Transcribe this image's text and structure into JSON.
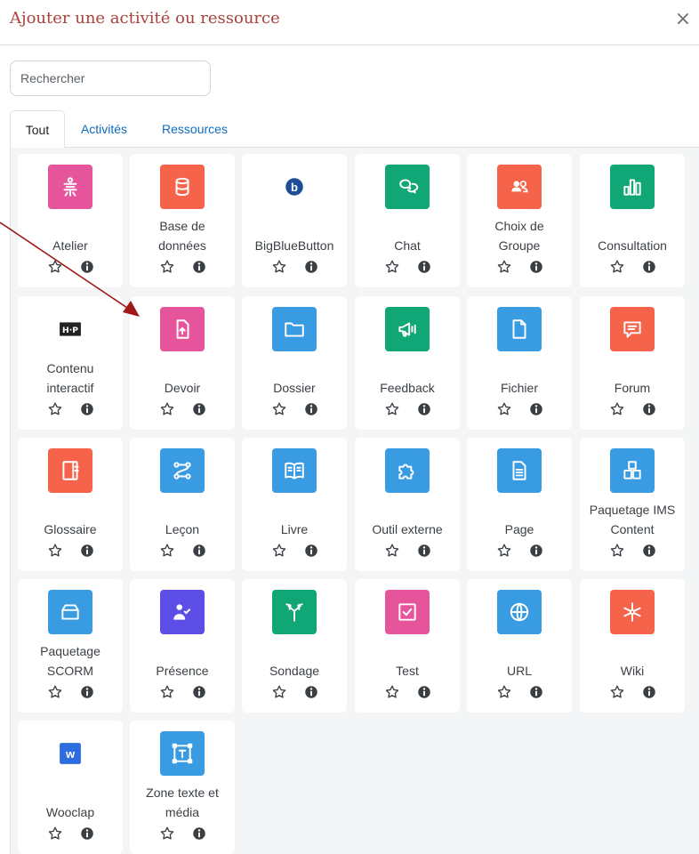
{
  "modal": {
    "title": "Ajouter une activité ou ressource",
    "close_glyph": "×"
  },
  "search": {
    "placeholder": "Rechercher",
    "value": ""
  },
  "tabs": [
    {
      "label": "Tout",
      "active": true
    },
    {
      "label": "Activités",
      "active": false
    },
    {
      "label": "Ressources",
      "active": false
    }
  ],
  "colors": {
    "title": "#a8423a",
    "link": "#0f6cbf",
    "pink": "#e6559b",
    "coral": "#f5634a",
    "green": "#11a676",
    "blue": "#399be2",
    "purple": "#5c4ee6",
    "annotation_arrow": "#a01818"
  },
  "items": [
    {
      "label": "Atelier",
      "icon": "atelier-icon",
      "color": "#e6559b"
    },
    {
      "label": "Base de\ndonnées",
      "icon": "database-icon",
      "color": "#f5634a"
    },
    {
      "label": "BigBlueButton",
      "icon": "bigbluebutton-icon",
      "color": ""
    },
    {
      "label": "Chat",
      "icon": "chat-icon",
      "color": "#11a676"
    },
    {
      "label": "Choix de\nGroupe",
      "icon": "group-choice-icon",
      "color": "#f5634a"
    },
    {
      "label": "Consultation",
      "icon": "bar-chart-icon",
      "color": "#11a676"
    },
    {
      "label": "Contenu\ninteractif",
      "icon": "h5p-icon",
      "color": ""
    },
    {
      "label": "Devoir",
      "icon": "assignment-icon",
      "color": "#e6559b"
    },
    {
      "label": "Dossier",
      "icon": "folder-icon",
      "color": "#399be2"
    },
    {
      "label": "Feedback",
      "icon": "megaphone-icon",
      "color": "#11a676"
    },
    {
      "label": "Fichier",
      "icon": "file-icon",
      "color": "#399be2"
    },
    {
      "label": "Forum",
      "icon": "forum-icon",
      "color": "#f5634a"
    },
    {
      "label": "Glossaire",
      "icon": "glossary-icon",
      "color": "#f5634a"
    },
    {
      "label": "Leçon",
      "icon": "lesson-icon",
      "color": "#399be2"
    },
    {
      "label": "Livre",
      "icon": "book-icon",
      "color": "#399be2"
    },
    {
      "label": "Outil externe",
      "icon": "puzzle-icon",
      "color": "#399be2"
    },
    {
      "label": "Page",
      "icon": "page-icon",
      "color": "#399be2"
    },
    {
      "label": "Paquetage IMS\nContent",
      "icon": "ims-package-icon",
      "color": "#399be2"
    },
    {
      "label": "Paquetage\nSCORM",
      "icon": "scorm-package-icon",
      "color": "#399be2"
    },
    {
      "label": "Présence",
      "icon": "attendance-icon",
      "color": "#5c4ee6"
    },
    {
      "label": "Sondage",
      "icon": "survey-icon",
      "color": "#11a676"
    },
    {
      "label": "Test",
      "icon": "quiz-icon",
      "color": "#e6559b"
    },
    {
      "label": "URL",
      "icon": "globe-icon",
      "color": "#399be2"
    },
    {
      "label": "Wiki",
      "icon": "wiki-icon",
      "color": "#f5634a"
    },
    {
      "label": "Wooclap",
      "icon": "wooclap-icon",
      "color": ""
    },
    {
      "label": "Zone texte et\nmédia",
      "icon": "text-media-icon",
      "color": "#399be2"
    }
  ]
}
